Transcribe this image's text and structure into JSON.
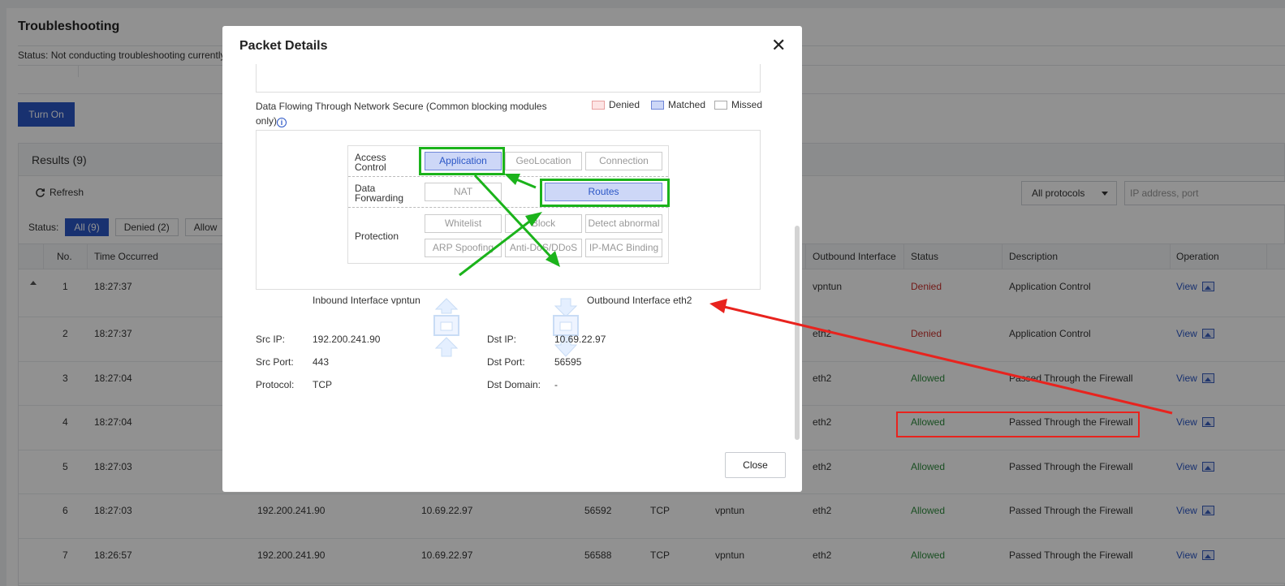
{
  "page": {
    "title": "Troubleshooting",
    "status_text": "Status: Not conducting troubleshooting currently",
    "turn_on_label": "Turn On"
  },
  "results": {
    "title": "Results (9)",
    "refresh_label": "Refresh",
    "protocol_select": "All protocols",
    "ip_placeholder": "IP address, port",
    "status_label": "Status:",
    "filters": [
      {
        "label": "All (9)",
        "active": true
      },
      {
        "label": "Denied (2)",
        "active": false
      },
      {
        "label": "Allow",
        "active": false
      }
    ],
    "columns": {
      "no": "No.",
      "time": "Time Occurred",
      "outbound": "Outbound Interface",
      "status": "Status",
      "description": "Description",
      "operation": "Operation"
    },
    "rows": [
      {
        "no": "1",
        "time": "18:27:37",
        "src": "",
        "dst": "",
        "port": "",
        "proto": "",
        "inbound": "",
        "outbound": "vpntun",
        "status": "Denied",
        "desc": "Application Control",
        "op": "View"
      },
      {
        "no": "2",
        "time": "18:27:37",
        "src": "",
        "dst": "",
        "port": "",
        "proto": "",
        "inbound": "",
        "outbound": "eth2",
        "status": "Denied",
        "desc": "Application Control",
        "op": "View"
      },
      {
        "no": "3",
        "time": "18:27:04",
        "src": "",
        "dst": "",
        "port": "",
        "proto": "",
        "inbound": "",
        "outbound": "eth2",
        "status": "Allowed",
        "desc": "Passed Through the Firewall",
        "op": "View"
      },
      {
        "no": "4",
        "time": "18:27:04",
        "src": "",
        "dst": "",
        "port": "",
        "proto": "",
        "inbound": "",
        "outbound": "eth2",
        "status": "Allowed",
        "desc": "Passed Through the Firewall",
        "op": "View"
      },
      {
        "no": "5",
        "time": "18:27:03",
        "src": "",
        "dst": "",
        "port": "",
        "proto": "",
        "inbound": "",
        "outbound": "eth2",
        "status": "Allowed",
        "desc": "Passed Through the Firewall",
        "op": "View"
      },
      {
        "no": "6",
        "time": "18:27:03",
        "src": "192.200.241.90",
        "dst": "10.69.22.97",
        "port": "56592",
        "proto": "TCP",
        "inbound": "vpntun",
        "outbound": "eth2",
        "status": "Allowed",
        "desc": "Passed Through the Firewall",
        "op": "View"
      },
      {
        "no": "7",
        "time": "18:26:57",
        "src": "192.200.241.90",
        "dst": "10.69.22.97",
        "port": "56588",
        "proto": "TCP",
        "inbound": "vpntun",
        "outbound": "eth2",
        "status": "Allowed",
        "desc": "Passed Through the Firewall",
        "op": "View"
      }
    ]
  },
  "modal": {
    "title": "Packet Details",
    "close_x": "✕",
    "flow_label": "Data Flowing Through Network Secure (Common blocking modules only)",
    "legend": {
      "denied": "Denied",
      "matched": "Matched",
      "missed": "Missed"
    },
    "categories": {
      "access": "Access Control",
      "forwarding": "Data Forwarding",
      "protection": "Protection"
    },
    "modules": {
      "application": "Application",
      "geolocation": "GeoLocation",
      "connection": "Connection",
      "nat": "NAT",
      "routes": "Routes",
      "whitelist": "Whitelist",
      "block": "Block",
      "detect_abnormal": "Detect abnormal",
      "arp_spoofing": "ARP Spoofing",
      "anti_dos": "Anti-DoS/DDoS",
      "ip_mac": "IP-MAC Binding"
    },
    "inbound_interface": "Inbound Interface vpntun",
    "outbound_interface": "Outbound Interface eth2",
    "details": {
      "src_ip_label": "Src IP:",
      "src_ip": "192.200.241.90",
      "src_port_label": "Src Port:",
      "src_port": "443",
      "protocol_label": "Protocol:",
      "protocol": "TCP",
      "dst_ip_label": "Dst IP:",
      "dst_ip": "10.69.22.97",
      "dst_port_label": "Dst Port:",
      "dst_port": "56595",
      "dst_domain_label": "Dst Domain:",
      "dst_domain": "-"
    },
    "close_button": "Close"
  },
  "colors": {
    "primary": "#2b56c6",
    "denied": "#c9302c",
    "allowed": "#2e8b3d",
    "matched_fill": "#cdd7f7",
    "annotation_green": "#1bb31b",
    "annotation_red": "#e8231e"
  }
}
